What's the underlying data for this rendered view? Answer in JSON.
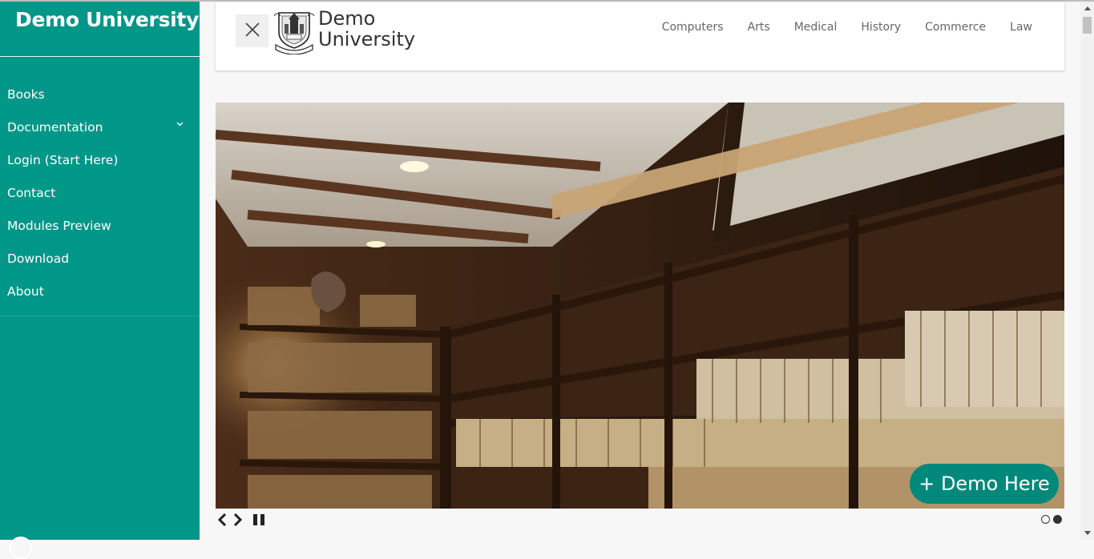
{
  "sidebar": {
    "brand": "Demo University",
    "items": [
      {
        "label": "Books"
      },
      {
        "label": "Documentation",
        "has_submenu": true
      },
      {
        "label": "Login (Start Here)"
      },
      {
        "label": "Contact"
      },
      {
        "label": "Modules Preview"
      },
      {
        "label": "Download"
      },
      {
        "label": "About"
      }
    ]
  },
  "header": {
    "close_icon": "close-icon",
    "logo_line1": "Demo",
    "logo_line2": "University",
    "nav": [
      "Computers",
      "Arts",
      "Medical",
      "History",
      "Commerce",
      "Law"
    ]
  },
  "hero": {
    "image": "library-bookshelves-photo",
    "cta_label": "+ Demo Here",
    "slides_total": 2,
    "active_slide": 2
  },
  "colors": {
    "sidebar": "#009688",
    "cta": "#00897b",
    "page_bg": "#f7f7f7"
  }
}
